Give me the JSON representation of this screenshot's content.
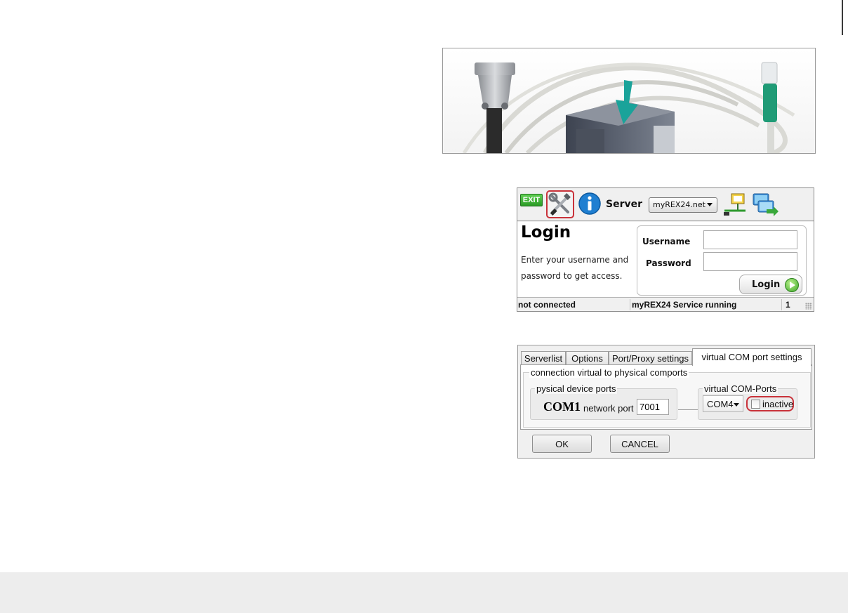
{
  "login_window": {
    "toolbar": {
      "exit_label": "EXIT",
      "server_label": "Server",
      "server_select_value": "myREX24.net"
    },
    "title": "Login",
    "description_line1": "Enter your username and",
    "description_line2": "password to get access.",
    "username_label": "Username",
    "password_label": "Password",
    "username_value": "",
    "password_value": "",
    "login_button": "Login",
    "status": {
      "connection": "not connected",
      "service": "myREX24 Service running",
      "count": "1"
    }
  },
  "settings_window": {
    "tabs": [
      {
        "label": "Serverlist"
      },
      {
        "label": "Options"
      },
      {
        "label": "Port/Proxy settings"
      },
      {
        "label": "virtual COM port settings",
        "active": true
      }
    ],
    "group_title": "connection virtual to physical comports",
    "physical_group_title": "pysical device ports",
    "physical_port": "COM1",
    "network_port_label": "network port",
    "network_port_value": "7001",
    "virtual_group_title": "virtual COM-Ports",
    "virtual_port_value": "COM4",
    "inactive_label": "inactive",
    "inactive_checked": false,
    "ok_button": "OK",
    "cancel_button": "CANCEL"
  },
  "icons": {
    "exit": "exit-icon",
    "tools": "tools-icon",
    "info": "info-icon",
    "network": "network-icon",
    "connect": "connect-icon",
    "login_go": "arrow-right-icon",
    "photo_arrow": "arrow-down-icon"
  },
  "colors": {
    "highlight_red": "#c9323a",
    "photo_arrow": "#1aa39a",
    "exit_green": "#2a9a25",
    "footer_gray": "#ededed"
  }
}
